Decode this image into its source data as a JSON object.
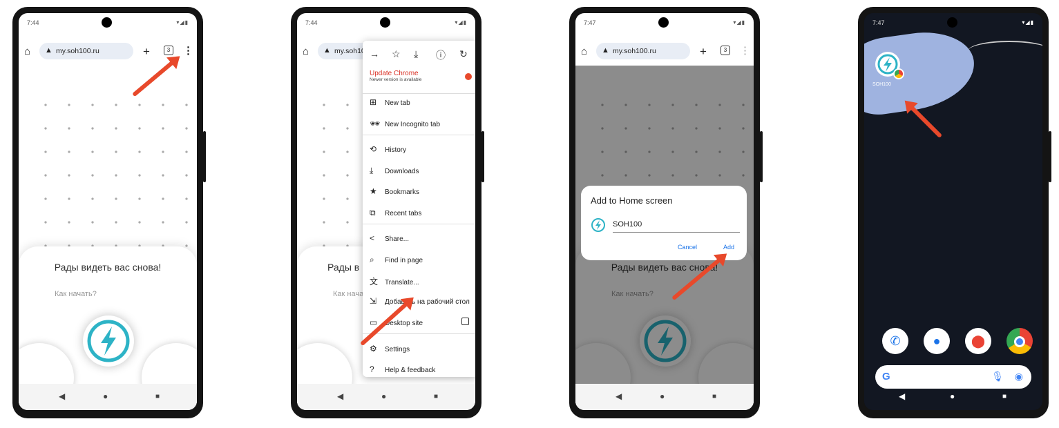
{
  "phone1": {
    "time": "7:44",
    "url": "my.soh100.ru",
    "tab_count": "3",
    "greeting": "Рады видеть вас снова!",
    "how_to_start": "Как начать?"
  },
  "phone2": {
    "time": "7:44",
    "url": "my.soh10",
    "greeting": "Рады в",
    "how_to_start": "Как нача",
    "menu": {
      "update_title": "Update Chrome",
      "update_sub": "Newer version is available",
      "items": [
        "New tab",
        "New Incognito tab",
        "History",
        "Downloads",
        "Bookmarks",
        "Recent tabs",
        "Share...",
        "Find in page",
        "Translate...",
        "Добавить на рабочий стол",
        "Desktop site",
        "Settings",
        "Help & feedback"
      ]
    }
  },
  "phone3": {
    "time": "7:47",
    "url": "my.soh100.ru",
    "tab_count": "3",
    "greeting": "Рады видеть вас снова!",
    "how_to_start": "Как начать?",
    "dialog": {
      "title": "Add to Home screen",
      "name_value": "SOH100",
      "cancel": "Cancel",
      "add": "Add"
    }
  },
  "phone4": {
    "time": "7:47",
    "app_label": "SOH100",
    "search_logo": "G"
  },
  "colors": {
    "accent_arrow": "#e8492b",
    "link_blue": "#1a73e8",
    "logo_teal": "#2db3c6"
  }
}
